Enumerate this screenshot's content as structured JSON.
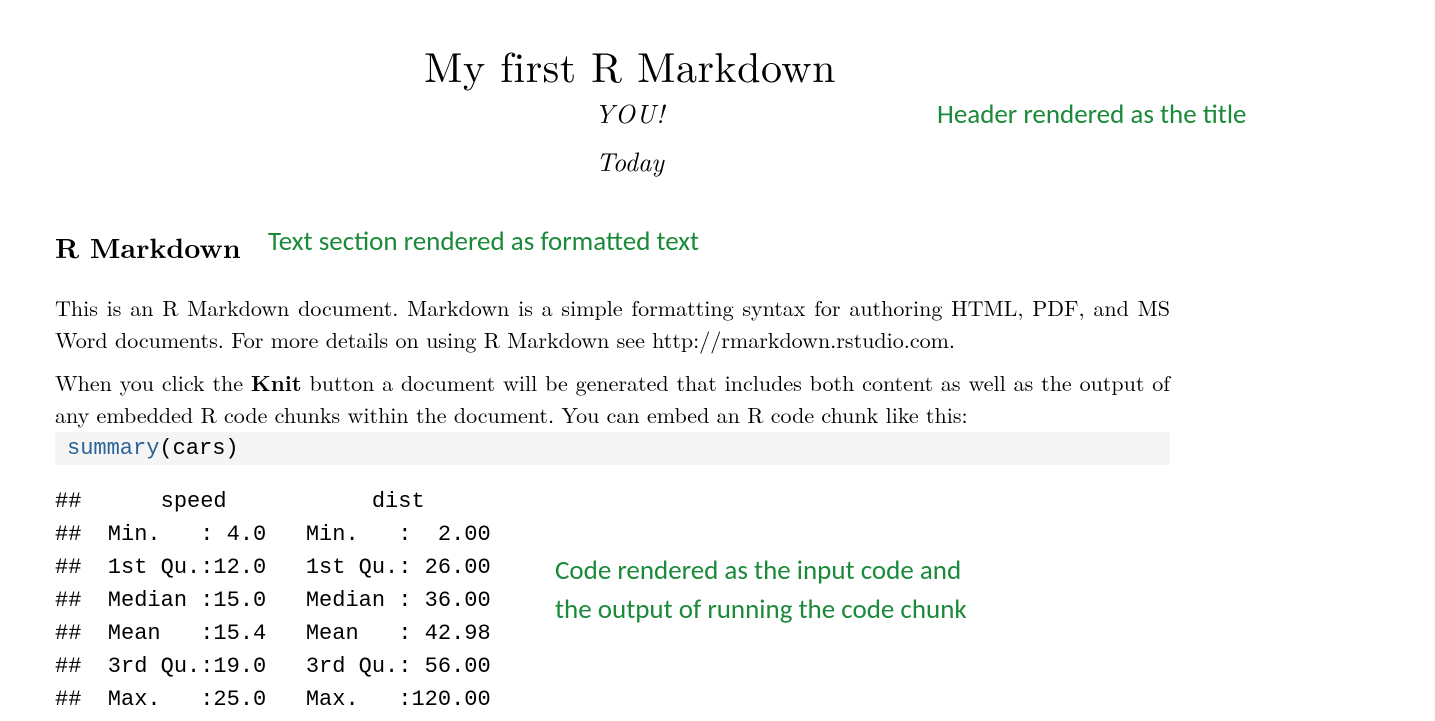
{
  "document": {
    "title": "My first R Markdown",
    "author": "YOU!",
    "date": "Today",
    "section_heading": "R Markdown",
    "paragraph1": "This is an R Markdown document. Markdown is a simple formatting syntax for authoring HTML, PDF, and MS Word documents. For more details on using R Markdown see http://rmarkdown.rstudio.com.",
    "paragraph2_pre": "When you click the ",
    "paragraph2_bold": "Knit",
    "paragraph2_post": " button a document will be generated that includes both content as well as the output of any embedded R code chunks within the document. You can embed an R code chunk like this:",
    "code": {
      "function": "summary",
      "args": "(cars)"
    },
    "output": "##      speed           dist\n##  Min.   : 4.0   Min.   :  2.00\n##  1st Qu.:12.0   1st Qu.: 26.00\n##  Median :15.0   Median : 36.00\n##  Mean   :15.4   Mean   : 42.98\n##  3rd Qu.:19.0   3rd Qu.: 56.00\n##  Max.   :25.0   Max.   :120.00"
  },
  "annotations": {
    "header": "Header rendered as the title",
    "text_section": "Text section rendered as formatted text",
    "code_line1": "Code rendered as the input code and",
    "code_line2": "the output of running the code chunk"
  }
}
